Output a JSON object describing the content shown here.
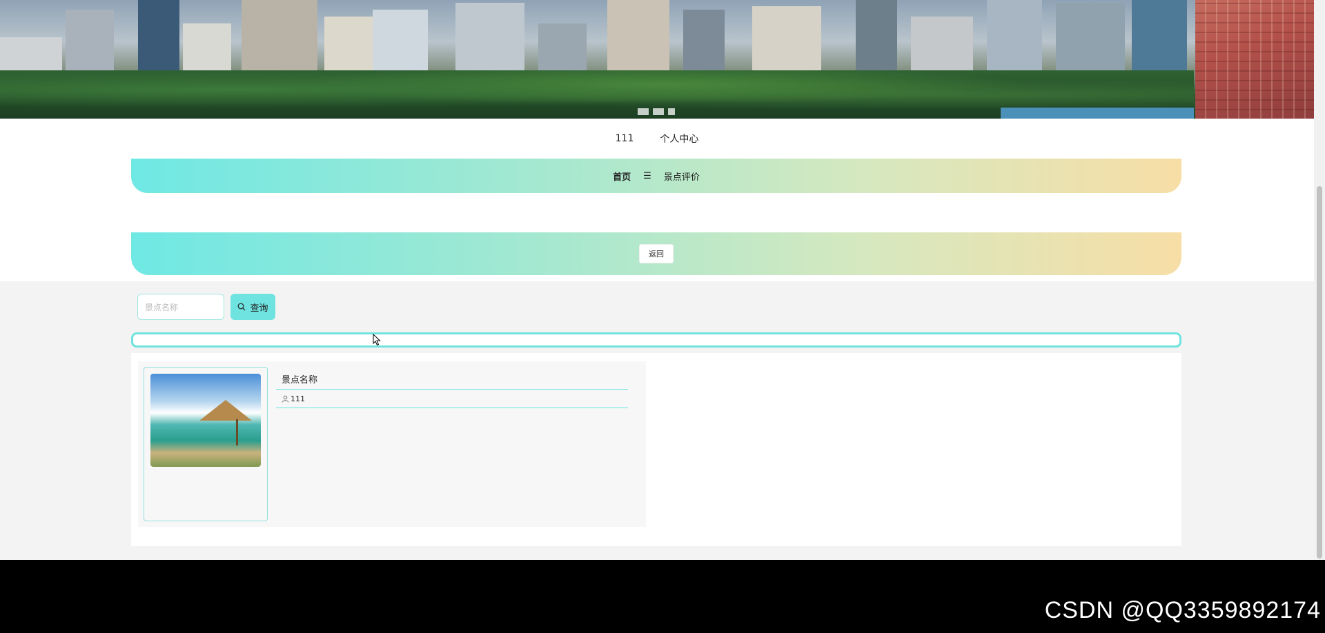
{
  "topnav": {
    "username": "111",
    "personal_center": "个人中心"
  },
  "menu": {
    "home": "首页",
    "separator_icon": "menu-icon",
    "separator_glyph": "☰",
    "review": "景点评价"
  },
  "back_button": "返回",
  "search": {
    "placeholder": "景点名称",
    "button_label": "查询",
    "button_icon": "search-icon"
  },
  "list": [
    {
      "title": "景点名称",
      "user": "111",
      "user_icon": "user-icon"
    }
  ],
  "watermark": "CSDN @QQ3359892174",
  "colors": {
    "accent": "#6ee3df",
    "gradient_start": "#6fe8e4",
    "gradient_end": "#f7dea6"
  }
}
